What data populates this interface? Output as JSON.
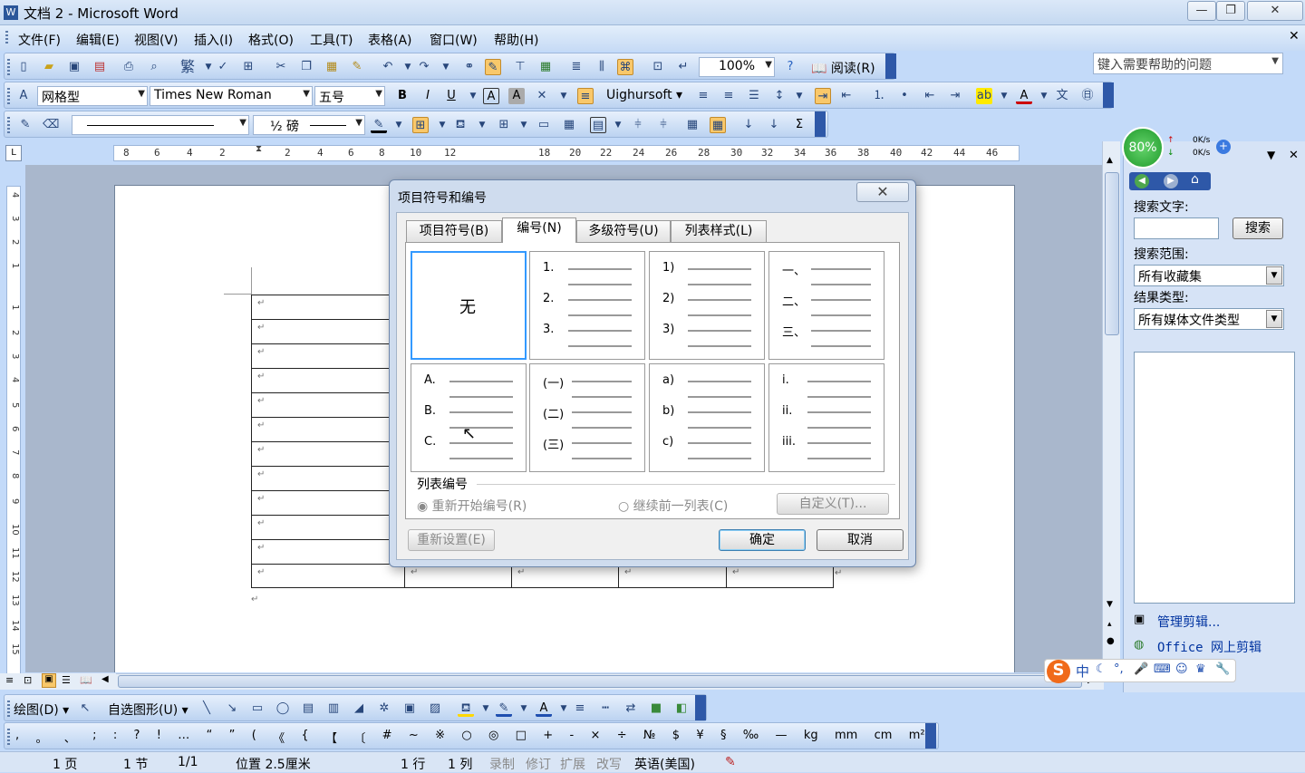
{
  "window": {
    "title": "文档 2 - Microsoft Word",
    "minimize": "—",
    "maximize": "❐",
    "close": "✕"
  },
  "menu": [
    "文件(F)",
    "编辑(E)",
    "视图(V)",
    "插入(I)",
    "格式(O)",
    "工具(T)",
    "表格(A)",
    "窗口(W)",
    "帮助(H)"
  ],
  "help_box": {
    "placeholder": "键入需要帮助的问题"
  },
  "standard_toolbar": {
    "zoom": "100%",
    "read_label": "阅读(R)"
  },
  "format_toolbar": {
    "style": "网格型",
    "font": "Times New Roman",
    "size": "五号",
    "uighur_font": "Uighursoft"
  },
  "tables_toolbar": {
    "line_weight": "½ 磅"
  },
  "ruler": {
    "h_ticks": [
      "8",
      "6",
      "4",
      "2",
      "2",
      "4",
      "6",
      "8",
      "10",
      "12",
      "",
      "18",
      "20",
      "22",
      "24",
      "26",
      "28",
      "30",
      "32",
      "34",
      "36",
      "38",
      "40",
      "42",
      "44",
      "46"
    ],
    "v_ticks": [
      "4",
      "3",
      "2",
      "1",
      "",
      "1",
      "2",
      "3",
      "4",
      "5",
      "6",
      "7",
      "8",
      "9",
      "10",
      "11",
      "12",
      "13",
      "14",
      "15",
      "16"
    ]
  },
  "doc": {
    "para_mark": "↵"
  },
  "dialog": {
    "title": "项目符号和编号",
    "tabs": [
      "项目符号(B)",
      "编号(N)",
      "多级符号(U)",
      "列表样式(L)"
    ],
    "gallery_none": "无",
    "gallery": [
      [
        "1.",
        "2.",
        "3."
      ],
      [
        "1)",
        "2)",
        "3)"
      ],
      [
        "一、",
        "二、",
        "三、"
      ],
      [
        "A.",
        "B.",
        "C."
      ],
      [
        "(一)",
        "(二)",
        "(三)"
      ],
      [
        "a)",
        "b)",
        "c)"
      ],
      [
        "i.",
        "ii.",
        "iii."
      ]
    ],
    "list_numbering_label": "列表编号",
    "restart_label": "重新开始编号(R)",
    "continue_label": "继续前一列表(C)",
    "customize_label": "自定义(T)...",
    "reset_label": "重新设置(E)",
    "ok_label": "确定",
    "cancel_label": "取消"
  },
  "task_pane": {
    "net_percent": "80%",
    "net_up": "0K/s",
    "net_down": "0K/s",
    "search_text_label": "搜索文字:",
    "search_button": "搜索",
    "scope_label": "搜索范围:",
    "scope_value": "所有收藏集",
    "type_label": "结果类型:",
    "type_value": "所有媒体文件类型",
    "link_manage": "管理剪辑...",
    "link_online": "Office 网上剪辑"
  },
  "draw_toolbar": {
    "draw_label": "绘图(D)",
    "autoshape_label": "自选图形(U)"
  },
  "symbols": [
    ",",
    "。",
    "、",
    ";",
    ":",
    "?",
    "!",
    "…",
    "“",
    "”",
    "(",
    "《",
    "{",
    "【",
    "〔",
    "#",
    "~",
    "※",
    "○",
    "◎",
    "□",
    "+",
    "-",
    "×",
    "÷",
    "№",
    "$",
    "¥",
    "§",
    "‰",
    "—",
    "kg",
    "mm",
    "cm",
    "m²"
  ],
  "ime": {
    "lang": "中"
  },
  "status": {
    "page": "1 页",
    "section": "1 节",
    "pages": "1/1",
    "position": "位置 2.5厘米",
    "line": "1 行",
    "col": "1 列",
    "rec": "录制",
    "trk": "修订",
    "ext": "扩展",
    "ovr": "改写",
    "lang": "英语(美国)"
  }
}
